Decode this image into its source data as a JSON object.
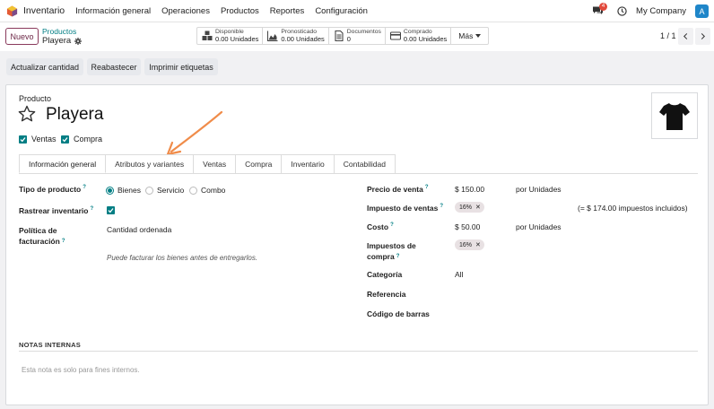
{
  "topnav": {
    "app_name": "Inventario",
    "menu": [
      "Información general",
      "Operaciones",
      "Productos",
      "Reportes",
      "Configuración"
    ],
    "chat_badge": "4",
    "company": "My Company",
    "avatar": "A"
  },
  "control_panel": {
    "new_label": "Nuevo",
    "breadcrumb_parent": "Productos",
    "breadcrumb_current": "Playera",
    "stats": [
      {
        "label": "Disponible",
        "value": "0.00 Unidades",
        "icon": "cubes-icon"
      },
      {
        "label": "Pronosticado",
        "value": "0.00 Unidades",
        "icon": "area-chart-icon"
      },
      {
        "label": "Documentos",
        "value": "0",
        "icon": "document-icon"
      },
      {
        "label": "Comprado",
        "value": "0.00 Unidades",
        "icon": "credit-card-icon"
      }
    ],
    "more_label": "Más",
    "pager": "1 / 1"
  },
  "actions": [
    "Actualizar cantidad",
    "Reabastecer",
    "Imprimir etiquetas"
  ],
  "form": {
    "product_label": "Producto",
    "name": "Playera",
    "can_be_sold": "Ventas",
    "can_be_purchased": "Compra",
    "tabs": [
      "Información general",
      "Atributos y variantes",
      "Ventas",
      "Compra",
      "Inventario",
      "Contabilidad"
    ],
    "active_tab": 0,
    "left": {
      "product_type_label": "Tipo de producto",
      "product_type_options": [
        "Bienes",
        "Servicio",
        "Combo"
      ],
      "product_type_selected": "Bienes",
      "track_inventory_label": "Rastrear inventario",
      "invoice_policy_label_1": "Política de",
      "invoice_policy_label_2": "facturación",
      "invoice_policy_value": "Cantidad ordenada",
      "invoice_policy_help": "Puede facturar los bienes antes de entregarlos."
    },
    "right": {
      "sale_price_label": "Precio de venta",
      "sale_price_value": "$ 150.00",
      "sale_price_uom": "por Unidades",
      "sales_tax_label": "Impuesto de ventas",
      "sales_tax_tag": "16%",
      "sales_tax_note": "(= $ 174.00 impuestos incluidos)",
      "cost_label": "Costo",
      "cost_value": "$ 50.00",
      "cost_uom": "por Unidades",
      "purchase_tax_label_1": "Impuestos de",
      "purchase_tax_label_2": "compra",
      "purchase_tax_tag": "16%",
      "category_label": "Categoría",
      "category_value": "All",
      "reference_label": "Referencia",
      "barcode_label": "Código de barras"
    },
    "notes_title": "NOTAS INTERNAS",
    "notes_placeholder": "Esta nota es solo para fines internos."
  },
  "colors": {
    "brand": "#714b67",
    "accent": "#017e84",
    "annotation_arrow": "#f08c4a"
  }
}
